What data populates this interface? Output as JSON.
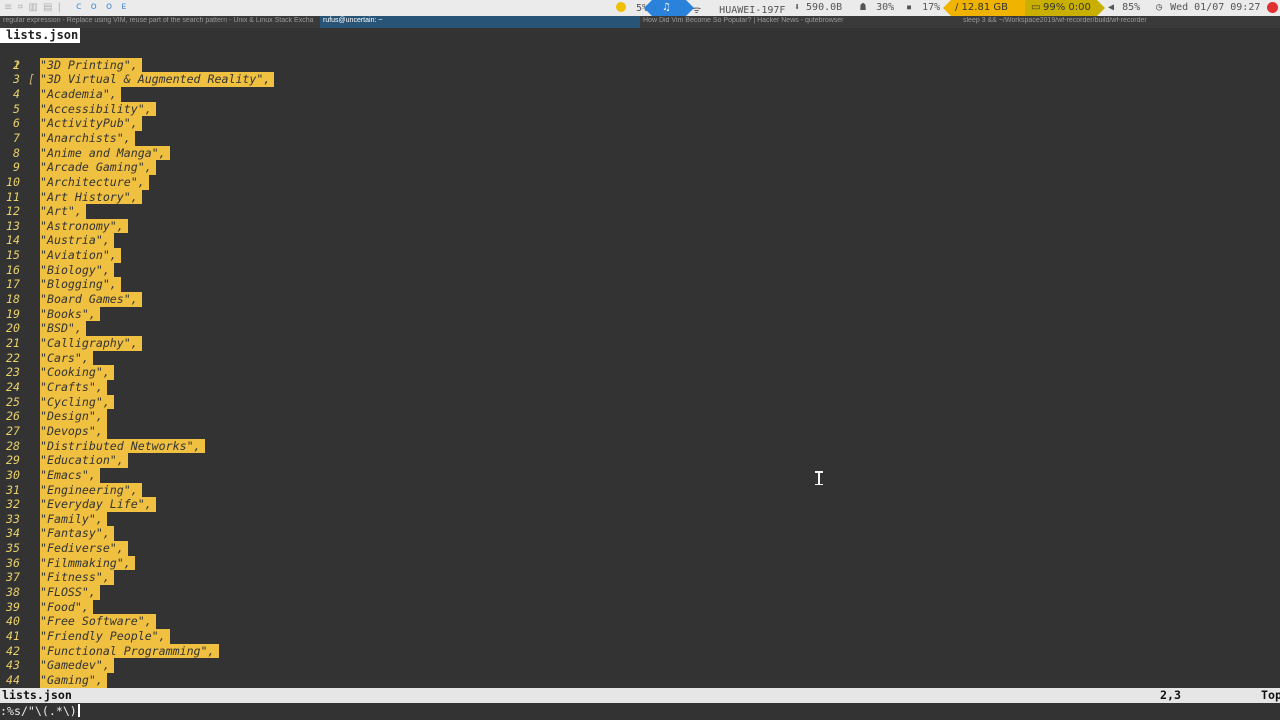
{
  "topbar": {
    "left_icons": "≡ ⌗ ▥ ▤ |",
    "workspaces": "ᴄ ᴏ ᴏ ᴇ",
    "weather": "5%",
    "music_icon": "♫",
    "wifi": "HUAWEI-197F",
    "net_down": "⬇ 590.0B",
    "cpu": "30%",
    "mem": "17%",
    "disk": "/ 12.81 GB",
    "battery": "99% 0:00",
    "volume": "85%",
    "clock": "Wed 01/07 09:27",
    "colors": {
      "music": "#2a82da",
      "disk": "#f0b400",
      "battery": "#c9b000",
      "power": "#e03030"
    }
  },
  "windows": [
    {
      "title": "regular expression - Replace using VIM, reuse part of the search pattern - Unix & Linux Stack Excha"
    },
    {
      "title": "rufus@uncertain: ~"
    },
    {
      "title": "How Did Vim Become So Popular? | Hacker News - qutebrowser"
    },
    {
      "title": "sleep 3 && ~/Workspace2019/wf-recorder/build/wf-recorder"
    }
  ],
  "editor": {
    "tab_name": "lists.json",
    "open_bracket": "[",
    "lines": [
      "\"3D Printing\",",
      "\"3D Virtual & Augmented Reality\",",
      "\"Academia\",",
      "\"Accessibility\",",
      "\"ActivityPub\",",
      "\"Anarchists\",",
      "\"Anime and Manga\",",
      "\"Arcade Gaming\",",
      "\"Architecture\",",
      "\"Art History\",",
      "\"Art\",",
      "\"Astronomy\",",
      "\"Austria\",",
      "\"Aviation\",",
      "\"Biology\",",
      "\"Blogging\",",
      "\"Board Games\",",
      "\"Books\",",
      "\"BSD\",",
      "\"Calligraphy\",",
      "\"Cars\",",
      "\"Cooking\",",
      "\"Crafts\",",
      "\"Cycling\",",
      "\"Design\",",
      "\"Devops\",",
      "\"Distributed Networks\",",
      "\"Education\",",
      "\"Emacs\",",
      "\"Engineering\",",
      "\"Everyday Life\",",
      "\"Family\",",
      "\"Fantasy\",",
      "\"Fediverse\",",
      "\"Filmmaking\",",
      "\"Fitness\",",
      "\"FLOSS\",",
      "\"Food\",",
      "\"Free Software\",",
      "\"Friendly People\",",
      "\"Functional Programming\",",
      "\"Gamedev\",",
      "\"Gaming\","
    ]
  },
  "statusline": {
    "filename": "lists.json",
    "position": "2,3",
    "scroll": "Top"
  },
  "cmdline": {
    "text": ":%s/\"\\(.*\\)"
  }
}
